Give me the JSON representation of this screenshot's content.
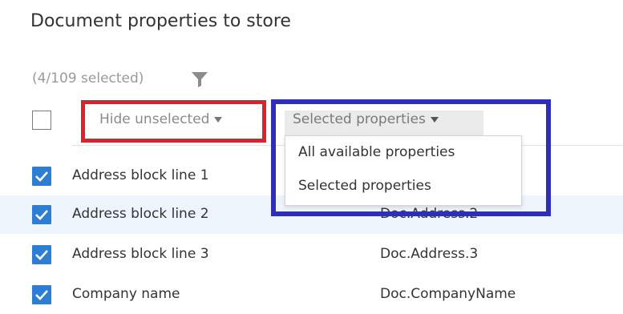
{
  "title": "Document properties to store",
  "selection": {
    "count_text": "(4/109 selected)"
  },
  "hide_dropdown": {
    "label": "Hide unselected"
  },
  "view_dropdown": {
    "label": "Selected properties",
    "options": [
      "All available properties",
      "Selected properties"
    ]
  },
  "rows": [
    {
      "label": "Address block line 1",
      "value": "",
      "checked": true
    },
    {
      "label": "Address block line 2",
      "value": "Doc.Address.2",
      "checked": true
    },
    {
      "label": "Address block line 3",
      "value": "Doc.Address.3",
      "checked": true
    },
    {
      "label": "Company name",
      "value": "Doc.CompanyName",
      "checked": true
    }
  ],
  "colors": {
    "accent": "#2d7dd2",
    "annotation_red": "#e0212a",
    "annotation_blue": "#2e2eb6",
    "row_highlight": "#eef4fb"
  },
  "icons": {
    "filter": "filter-icon",
    "checkmark": "checkmark-icon",
    "caret": "caret-down-icon"
  }
}
